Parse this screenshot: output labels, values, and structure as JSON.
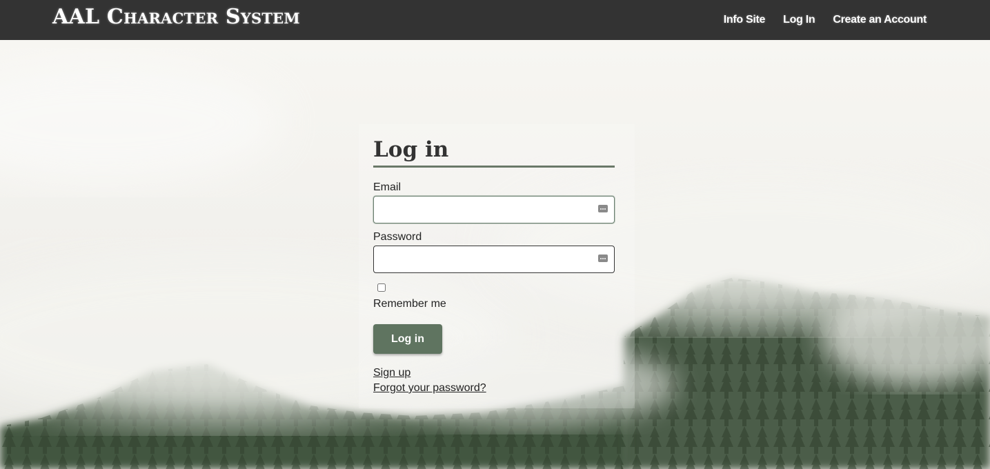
{
  "navbar": {
    "brand": "AAL Character System",
    "links": [
      "Info Site",
      "Log In",
      "Create an Account"
    ]
  },
  "form": {
    "title": "Log in",
    "email_label": "Email",
    "email_value": "",
    "password_label": "Password",
    "password_value": "",
    "remember_label": "Remember me",
    "remember_checked": false,
    "submit_label": "Log in",
    "signup_link": "Sign up",
    "forgot_link": "Forgot your password?"
  },
  "icons": {
    "field_autofill": "password-manager-key-icon"
  },
  "colors": {
    "navbar_bg": "#333333",
    "accent": "#5f7460",
    "title_underline": "#6a7868"
  }
}
